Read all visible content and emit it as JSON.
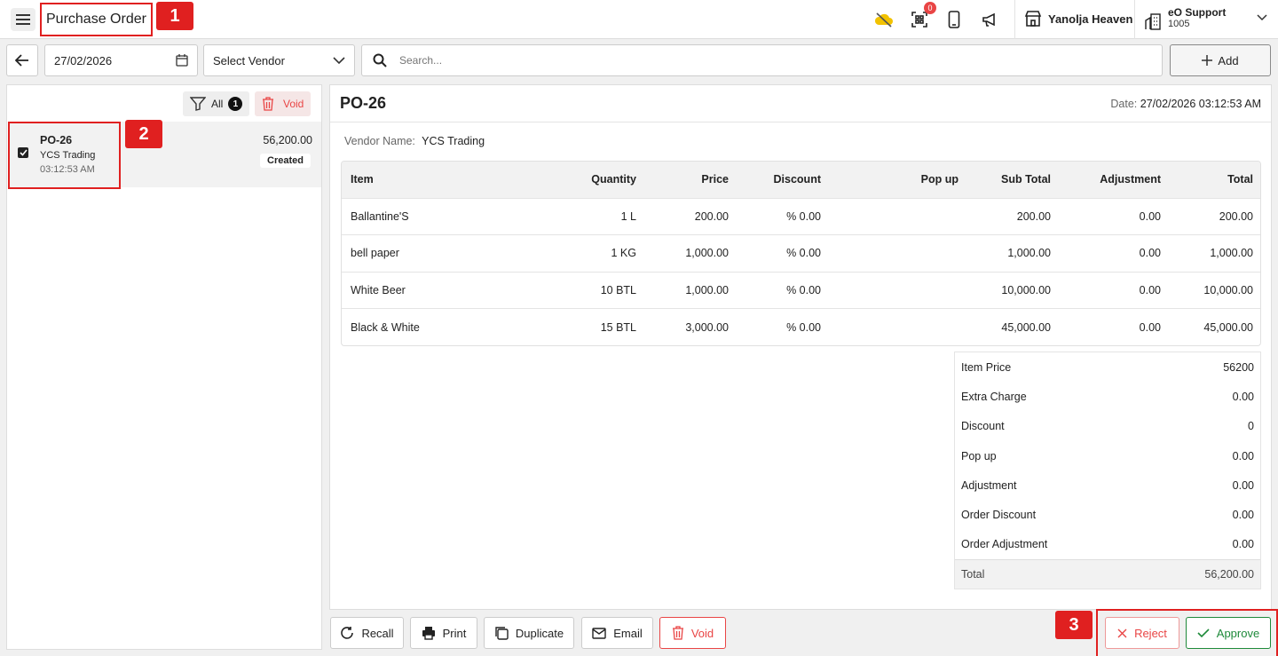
{
  "app": {
    "title": "Purchase Order",
    "callouts": [
      "1",
      "2",
      "3"
    ],
    "notification_count": "0"
  },
  "header": {
    "hotel_name": "Yanolja Heaven",
    "user_name": "eO Support",
    "user_id": "1005"
  },
  "toolbar": {
    "date": "27/02/2026",
    "vendor_placeholder": "Select Vendor",
    "search_placeholder": "Search...",
    "add_label": "Add"
  },
  "list": {
    "filter_label": "All",
    "filter_count": "1",
    "void_label": "Void",
    "items": [
      {
        "id": "PO-26",
        "vendor": "YCS Trading",
        "time": "03:12:53 AM",
        "amount": "56,200.00",
        "status": "Created"
      }
    ]
  },
  "detail": {
    "po_number": "PO-26",
    "date_label": "Date:",
    "date_value": "27/02/2026 03:12:53 AM",
    "vendor_label": "Vendor Name:",
    "vendor_value": "YCS Trading",
    "columns": [
      "Item",
      "Quantity",
      "Price",
      "Discount",
      "Pop up",
      "Sub Total",
      "Adjustment",
      "Total"
    ],
    "rows": [
      [
        "Ballantine'S",
        "1 L",
        "200.00",
        "% 0.00",
        "",
        "200.00",
        "0.00",
        "200.00"
      ],
      [
        "bell paper",
        "1 KG",
        "1,000.00",
        "% 0.00",
        "",
        "1,000.00",
        "0.00",
        "1,000.00"
      ],
      [
        "White Beer",
        "10 BTL",
        "1,000.00",
        "% 0.00",
        "",
        "10,000.00",
        "0.00",
        "10,000.00"
      ],
      [
        "Black & White",
        "15 BTL",
        "3,000.00",
        "% 0.00",
        "",
        "45,000.00",
        "0.00",
        "45,000.00"
      ]
    ],
    "summary": [
      {
        "label": "Item Price",
        "value": "56200"
      },
      {
        "label": "Extra Charge",
        "value": "0.00"
      },
      {
        "label": "Discount",
        "value": "0"
      },
      {
        "label": "Pop up",
        "value": "0.00"
      },
      {
        "label": "Adjustment",
        "value": "0.00"
      },
      {
        "label": "Order Discount",
        "value": "0.00"
      },
      {
        "label": "Order Adjustment",
        "value": "0.00"
      },
      {
        "label": "Total",
        "value": "56,200.00"
      }
    ]
  },
  "actions": {
    "recall": "Recall",
    "print": "Print",
    "duplicate": "Duplicate",
    "email": "Email",
    "void": "Void",
    "reject": "Reject",
    "approve": "Approve"
  },
  "colors": {
    "accent_red": "#e02020",
    "approve_green": "#1e8a3a",
    "void_red": "#e94545"
  }
}
